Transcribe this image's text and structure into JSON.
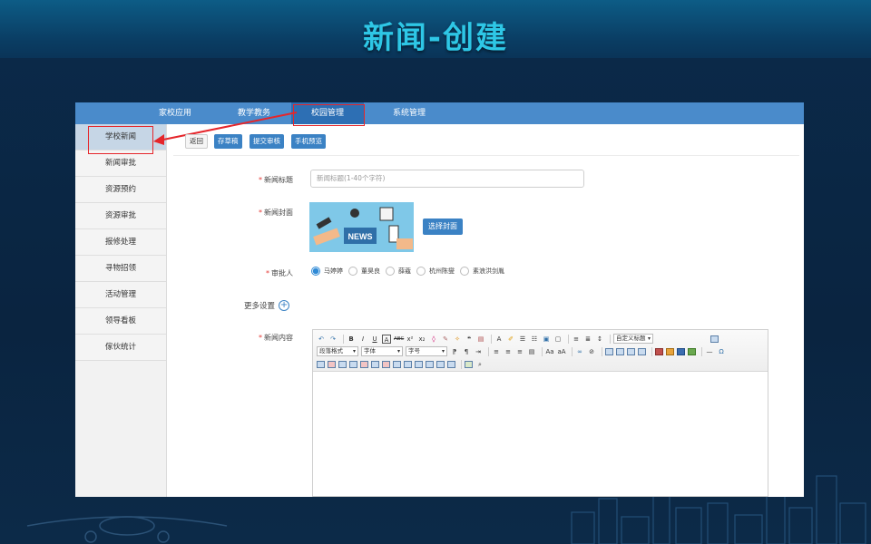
{
  "slide": {
    "title": "新闻-创建"
  },
  "topnav": {
    "items": [
      {
        "label": "家校应用"
      },
      {
        "label": "教学教务"
      },
      {
        "label": "校园管理",
        "active": true
      },
      {
        "label": "系统管理"
      }
    ]
  },
  "sidebar": {
    "items": [
      {
        "label": "学校新闻",
        "active": true
      },
      {
        "label": "新闻审批"
      },
      {
        "label": "资源预约"
      },
      {
        "label": "资源审批"
      },
      {
        "label": "报修处理"
      },
      {
        "label": "寻物招领"
      },
      {
        "label": "活动管理"
      },
      {
        "label": "领导看板"
      },
      {
        "label": "傢伙统计"
      }
    ]
  },
  "toolbar": {
    "back_label": "返回",
    "draft_label": "存草稿",
    "submit_label": "提交审核",
    "preview_label": "手机预览"
  },
  "form": {
    "required_mark": "*",
    "title_label": "新闻标题",
    "title_placeholder": "新闻标题(1-40个字符)",
    "cover_label": "新闻封面",
    "cover_image_text": "NEWS",
    "cover_button": "选择封面",
    "approver_label": "审批人",
    "approvers": [
      {
        "name": "马婷婷",
        "checked": true
      },
      {
        "name": "董昊良",
        "checked": false
      },
      {
        "name": "薛蔻",
        "checked": false
      },
      {
        "name": "杭州陈燮",
        "checked": false
      },
      {
        "name": "素浪洪剑胤",
        "checked": false
      }
    ],
    "more_settings": "更多设置",
    "content_label": "新闻内容"
  },
  "editor": {
    "custom_title_select": "自定义标题",
    "paragraph_select": "段落格式",
    "font_select": "字体",
    "size_select": "字号"
  },
  "colors": {
    "title_cyan": "#2ec7e6",
    "nav_blue": "#4a8bcb",
    "button_blue": "#3b82c4",
    "highlight_red": "#e5262b",
    "required_red": "#e53935"
  }
}
